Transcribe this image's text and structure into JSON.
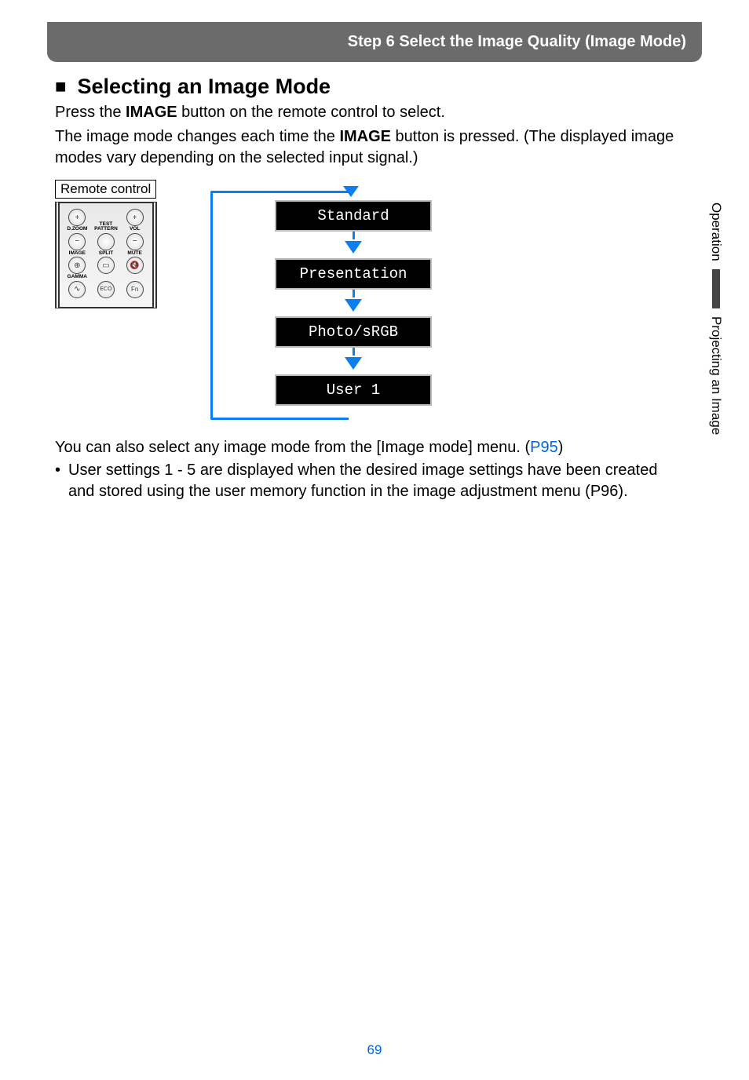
{
  "header": {
    "title": "Step 6 Select the Image Quality (Image Mode)"
  },
  "section": {
    "bullet": "■",
    "heading": "Selecting an Image Mode",
    "para1_a": "Press the ",
    "para1_b": "IMAGE",
    "para1_c": " button on the remote control to select.",
    "para2_a": "The image mode changes each time the ",
    "para2_b": "IMAGE",
    "para2_c": " button is pressed. (The displayed image modes vary depending on the selected input signal.)"
  },
  "remote": {
    "label": "Remote control",
    "labels": {
      "dzoom": "D.ZOOM",
      "test": "TEST PATTERN",
      "vol": "VOL",
      "image": "IMAGE",
      "split": "SPLIT",
      "mute": "MUTE",
      "gamma": "GAMMA",
      "eco": "ECO",
      "fn": "Fn"
    }
  },
  "flow": {
    "modes": [
      "Standard",
      "Presentation",
      "Photo/sRGB",
      "User 1"
    ]
  },
  "lower": {
    "line1_a": "You can also select any image mode from the [Image mode] menu. (",
    "line1_link": "P95",
    "line1_b": ")",
    "bullet_a": "User settings 1 - 5 are displayed when the desired image settings have been created and stored using the user memory function in the image adjustment menu (",
    "bullet_link": "P96",
    "bullet_b": ")."
  },
  "side": {
    "tab1": "Operation",
    "tab2": "Projecting an Image"
  },
  "page_number": "69"
}
